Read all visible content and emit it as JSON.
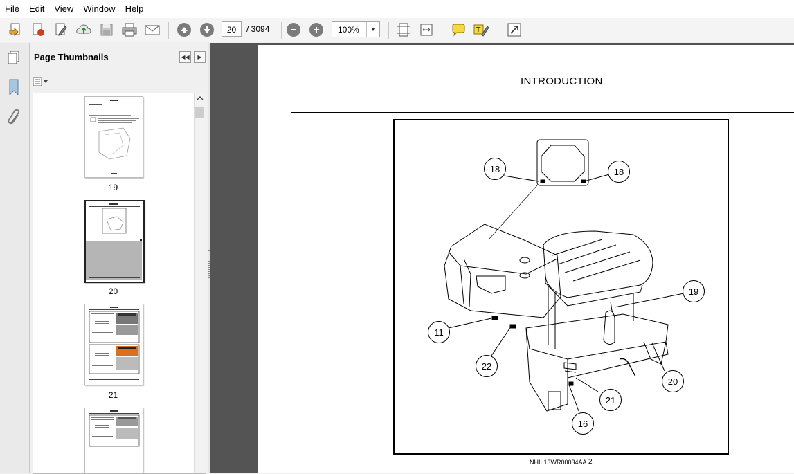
{
  "menu": [
    "File",
    "Edit",
    "View",
    "Window",
    "Help"
  ],
  "toolbar": {
    "current_page": "20",
    "total_pages": "/ 3094",
    "zoom": "100%"
  },
  "panel": {
    "title": "Page Thumbnails",
    "thumbnails": [
      {
        "label": "19"
      },
      {
        "label": "20"
      },
      {
        "label": "21"
      },
      {
        "label": ""
      }
    ]
  },
  "document": {
    "title": "INTRODUCTION",
    "figure_code": "NHIL13WR00034AA",
    "page_number": "2",
    "callouts": [
      "18",
      "18",
      "19",
      "11",
      "22",
      "20",
      "21",
      "16"
    ]
  }
}
